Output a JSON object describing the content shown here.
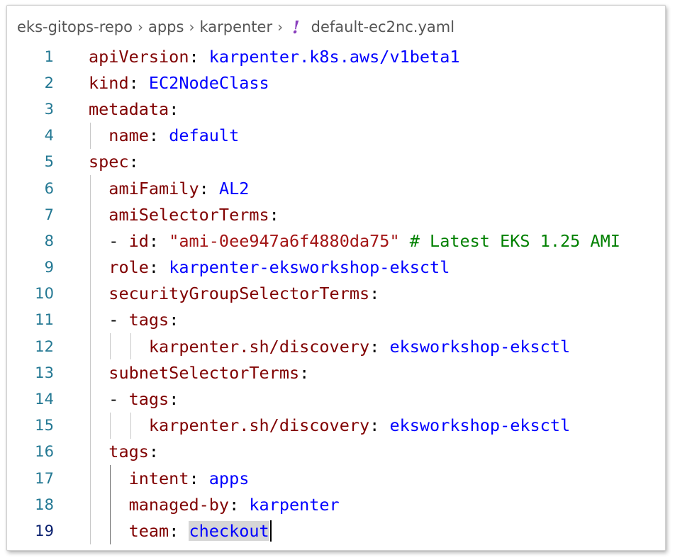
{
  "breadcrumb": {
    "items": [
      "eks-gitops-repo",
      "apps",
      "karpenter"
    ],
    "separator": "›",
    "file_icon": "!",
    "file_icon_name": "yaml-file-icon",
    "filename": "default-ec2nc.yaml"
  },
  "editor": {
    "active_line": 19,
    "lines": [
      {
        "n": "1",
        "tokens": [
          {
            "t": "key",
            "v": "apiVersion"
          },
          {
            "t": "plain",
            "v": ": "
          },
          {
            "t": "val",
            "v": "karpenter.k8s.aws/v1beta1"
          }
        ]
      },
      {
        "n": "2",
        "tokens": [
          {
            "t": "key",
            "v": "kind"
          },
          {
            "t": "plain",
            "v": ": "
          },
          {
            "t": "val",
            "v": "EC2NodeClass"
          }
        ]
      },
      {
        "n": "3",
        "tokens": [
          {
            "t": "key",
            "v": "metadata"
          },
          {
            "t": "plain",
            "v": ":"
          }
        ]
      },
      {
        "n": "4",
        "tokens": [
          {
            "t": "plain",
            "v": "  "
          },
          {
            "t": "key",
            "v": "name"
          },
          {
            "t": "plain",
            "v": ": "
          },
          {
            "t": "val",
            "v": "default"
          }
        ]
      },
      {
        "n": "5",
        "tokens": [
          {
            "t": "key",
            "v": "spec"
          },
          {
            "t": "plain",
            "v": ":"
          }
        ]
      },
      {
        "n": "6",
        "tokens": [
          {
            "t": "plain",
            "v": "  "
          },
          {
            "t": "key",
            "v": "amiFamily"
          },
          {
            "t": "plain",
            "v": ": "
          },
          {
            "t": "val",
            "v": "AL2"
          }
        ]
      },
      {
        "n": "7",
        "tokens": [
          {
            "t": "plain",
            "v": "  "
          },
          {
            "t": "key",
            "v": "amiSelectorTerms"
          },
          {
            "t": "plain",
            "v": ":"
          }
        ]
      },
      {
        "n": "8",
        "tokens": [
          {
            "t": "plain",
            "v": "  - "
          },
          {
            "t": "key",
            "v": "id"
          },
          {
            "t": "plain",
            "v": ": "
          },
          {
            "t": "str",
            "v": "\"ami-0ee947a6f4880da75\""
          },
          {
            "t": "plain",
            "v": " "
          },
          {
            "t": "cmt",
            "v": "# Latest EKS 1.25 AMI"
          }
        ]
      },
      {
        "n": "9",
        "tokens": [
          {
            "t": "plain",
            "v": "  "
          },
          {
            "t": "key",
            "v": "role"
          },
          {
            "t": "plain",
            "v": ": "
          },
          {
            "t": "val",
            "v": "karpenter-eksworkshop-eksctl"
          }
        ]
      },
      {
        "n": "10",
        "tokens": [
          {
            "t": "plain",
            "v": "  "
          },
          {
            "t": "key",
            "v": "securityGroupSelectorTerms"
          },
          {
            "t": "plain",
            "v": ":"
          }
        ]
      },
      {
        "n": "11",
        "tokens": [
          {
            "t": "plain",
            "v": "  - "
          },
          {
            "t": "key",
            "v": "tags"
          },
          {
            "t": "plain",
            "v": ":"
          }
        ]
      },
      {
        "n": "12",
        "tokens": [
          {
            "t": "plain",
            "v": "      "
          },
          {
            "t": "key",
            "v": "karpenter.sh/discovery"
          },
          {
            "t": "plain",
            "v": ": "
          },
          {
            "t": "val",
            "v": "eksworkshop-eksctl"
          }
        ]
      },
      {
        "n": "13",
        "tokens": [
          {
            "t": "plain",
            "v": "  "
          },
          {
            "t": "key",
            "v": "subnetSelectorTerms"
          },
          {
            "t": "plain",
            "v": ":"
          }
        ]
      },
      {
        "n": "14",
        "tokens": [
          {
            "t": "plain",
            "v": "  - "
          },
          {
            "t": "key",
            "v": "tags"
          },
          {
            "t": "plain",
            "v": ":"
          }
        ]
      },
      {
        "n": "15",
        "tokens": [
          {
            "t": "plain",
            "v": "      "
          },
          {
            "t": "key",
            "v": "karpenter.sh/discovery"
          },
          {
            "t": "plain",
            "v": ": "
          },
          {
            "t": "val",
            "v": "eksworkshop-eksctl"
          }
        ]
      },
      {
        "n": "16",
        "tokens": [
          {
            "t": "plain",
            "v": "  "
          },
          {
            "t": "key",
            "v": "tags"
          },
          {
            "t": "plain",
            "v": ":"
          }
        ]
      },
      {
        "n": "17",
        "tokens": [
          {
            "t": "plain",
            "v": "    "
          },
          {
            "t": "key",
            "v": "intent"
          },
          {
            "t": "plain",
            "v": ": "
          },
          {
            "t": "val",
            "v": "apps"
          }
        ]
      },
      {
        "n": "18",
        "tokens": [
          {
            "t": "plain",
            "v": "    "
          },
          {
            "t": "key",
            "v": "managed-by"
          },
          {
            "t": "plain",
            "v": ": "
          },
          {
            "t": "val",
            "v": "karpenter"
          }
        ]
      },
      {
        "n": "19",
        "tokens": [
          {
            "t": "plain",
            "v": "    "
          },
          {
            "t": "key",
            "v": "team"
          },
          {
            "t": "plain",
            "v": ": "
          },
          {
            "t": "val",
            "v": "checkout",
            "selected": true
          }
        ]
      }
    ]
  },
  "colors": {
    "key": "#800000",
    "value": "#0000ff",
    "string": "#a31515",
    "comment": "#008000",
    "line_number": "#237893",
    "yaml_icon": "#8a3fbd"
  }
}
